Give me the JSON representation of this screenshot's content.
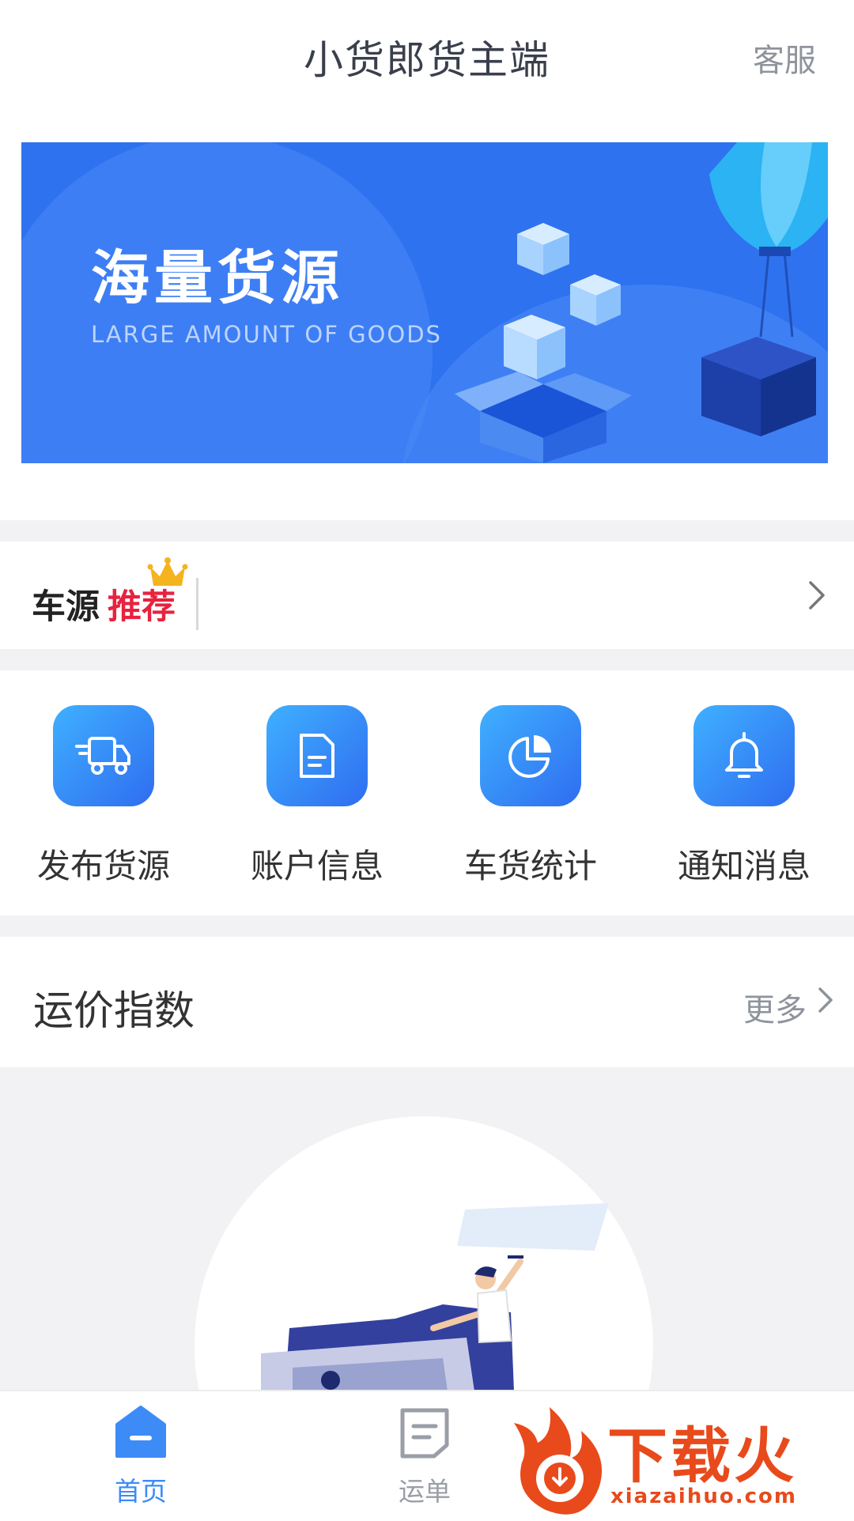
{
  "header": {
    "title": "小货郎货主端",
    "service_label": "客服"
  },
  "banner": {
    "headline": "海量货源",
    "subtitle": "LARGE AMOUNT OF GOODS"
  },
  "recommend": {
    "label_part1": "车源",
    "label_part2": "推荐",
    "icons": {
      "crown": "crown-icon",
      "arrow": "chevron-right-icon"
    }
  },
  "quick_actions": [
    {
      "label": "发布货源",
      "icon": "truck-icon"
    },
    {
      "label": "账户信息",
      "icon": "document-icon"
    },
    {
      "label": "车货统计",
      "icon": "pie-chart-icon"
    },
    {
      "label": "通知消息",
      "icon": "bell-icon"
    }
  ],
  "freight_index": {
    "title": "运价指数",
    "more_label": "更多"
  },
  "tabbar": {
    "items": [
      {
        "label": "首页",
        "icon": "home-icon",
        "active": true
      },
      {
        "label": "运单",
        "icon": "waybill-icon",
        "active": false
      }
    ]
  },
  "watermark": {
    "text": "下载火",
    "url": "xiazaihuo.com"
  },
  "colors": {
    "primary": "#2f72f0",
    "accent_red": "#e8223e",
    "text": "#333333",
    "muted": "#8e939c",
    "bg_gray": "#f2f2f4",
    "watermark": "#e84a1c"
  }
}
